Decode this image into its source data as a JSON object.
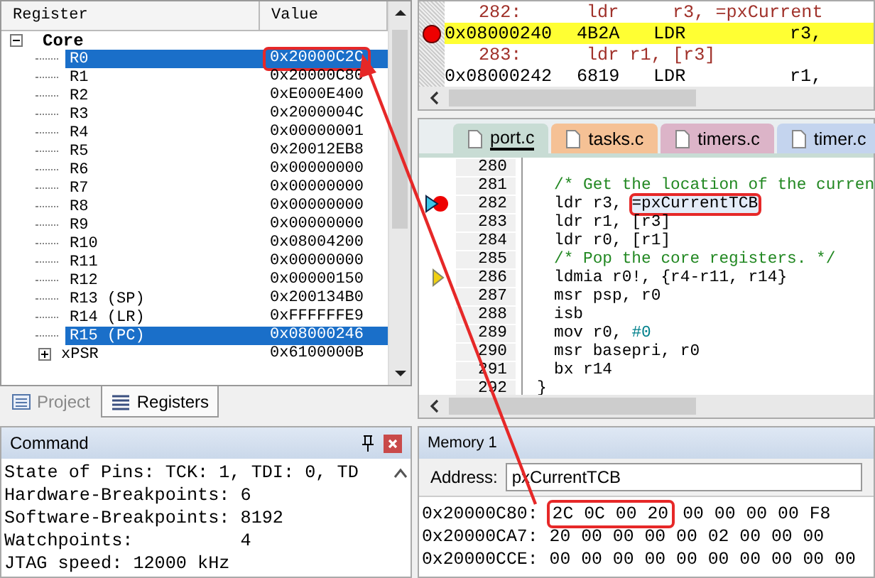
{
  "registers": {
    "columns": [
      "Register",
      "Value"
    ],
    "tree": [
      {
        "name": "Core",
        "expanded": true,
        "children": [
          {
            "name": "R0",
            "value": "0x20000C2C",
            "selected": true,
            "boxed": true
          },
          {
            "name": "R1",
            "value": "0x20000C80",
            "selected": false,
            "boxed": false
          },
          {
            "name": "R2",
            "value": "0xE000E400",
            "selected": false,
            "boxed": false
          },
          {
            "name": "R3",
            "value": "0x2000004C",
            "selected": false,
            "boxed": false
          },
          {
            "name": "R4",
            "value": "0x00000001",
            "selected": false,
            "boxed": false
          },
          {
            "name": "R5",
            "value": "0x20012EB8",
            "selected": false,
            "boxed": false
          },
          {
            "name": "R6",
            "value": "0x00000000",
            "selected": false,
            "boxed": false
          },
          {
            "name": "R7",
            "value": "0x00000000",
            "selected": false,
            "boxed": false
          },
          {
            "name": "R8",
            "value": "0x00000000",
            "selected": false,
            "boxed": false
          },
          {
            "name": "R9",
            "value": "0x00000000",
            "selected": false,
            "boxed": false
          },
          {
            "name": "R10",
            "value": "0x08004200",
            "selected": false,
            "boxed": false
          },
          {
            "name": "R11",
            "value": "0x00000000",
            "selected": false,
            "boxed": false
          },
          {
            "name": "R12",
            "value": "0x00000150",
            "selected": false,
            "boxed": false
          },
          {
            "name": "R13 (SP)",
            "value": "0x200134B0",
            "selected": false,
            "boxed": false
          },
          {
            "name": "R14 (LR)",
            "value": "0xFFFFFFE9",
            "selected": false,
            "boxed": false
          },
          {
            "name": "R15 (PC)",
            "value": "0x08000246",
            "selected": true,
            "boxed": false
          }
        ]
      },
      {
        "name": "xPSR",
        "value": "0x6100000B",
        "expanded": false
      }
    ]
  },
  "left_tabs": [
    {
      "label": "Project",
      "selected": false
    },
    {
      "label": "Registers",
      "selected": true
    }
  ],
  "command": {
    "title": "Command",
    "lines": [
      "State of Pins: TCK: 1, TDI: 0, TD",
      "Hardware-Breakpoints: 6",
      "Software-Breakpoints: 8192",
      "Watchpoints:          4",
      "JTAG speed: 12000 kHz"
    ]
  },
  "disassembly": {
    "lines": [
      {
        "kind": "source",
        "number": "282:",
        "code": "ldr     r3, =pxCurrent"
      },
      {
        "kind": "instruction",
        "address": "0x08000240",
        "opcode": "4B2A",
        "mnemonic": "LDR",
        "operands": "r3,",
        "current": true,
        "breakpoint": true
      },
      {
        "kind": "source",
        "number": "283:",
        "code": "ldr r1, [r3]"
      },
      {
        "kind": "instruction",
        "address": "0x08000242",
        "opcode": "6819",
        "mnemonic": "LDR",
        "operands": "r1,",
        "current": false,
        "breakpoint": false
      }
    ]
  },
  "editor": {
    "tabs": [
      {
        "label": "port.c",
        "selected": true,
        "color": "#c8dcd4"
      },
      {
        "label": "tasks.c",
        "selected": false,
        "color": "#f5c195"
      },
      {
        "label": "timers.c",
        "selected": false,
        "color": "#dcb4c8"
      },
      {
        "label": "timer.c",
        "selected": false,
        "color": "#c4d4ee"
      }
    ],
    "lines": [
      {
        "number": "280",
        "breakpoint": false,
        "current": false,
        "caller": false
      },
      {
        "number": "281",
        "breakpoint": false,
        "current": false,
        "caller": false,
        "parts": [
          {
            "kind": "comment",
            "text": "/* Get the location of the curren",
            "boxed": false
          }
        ]
      },
      {
        "number": "282",
        "breakpoint": true,
        "current": true,
        "caller": false,
        "parts": [
          {
            "kind": "code",
            "text": "ldr r3, ",
            "boxed": false
          },
          {
            "kind": "code",
            "text": "=pxCurrentTCB",
            "boxed": true
          }
        ]
      },
      {
        "number": "283",
        "breakpoint": false,
        "current": false,
        "caller": false,
        "parts": [
          {
            "kind": "code",
            "text": "ldr r1, [r3]",
            "boxed": false
          }
        ]
      },
      {
        "number": "284",
        "breakpoint": false,
        "current": false,
        "caller": false,
        "parts": [
          {
            "kind": "code",
            "text": "ldr r0, [r1]",
            "boxed": false
          }
        ]
      },
      {
        "number": "285",
        "breakpoint": false,
        "current": false,
        "caller": false,
        "parts": [
          {
            "kind": "comment",
            "text": "/* Pop the core registers. */",
            "boxed": false
          }
        ]
      },
      {
        "number": "286",
        "breakpoint": false,
        "current": false,
        "caller": true,
        "parts": [
          {
            "kind": "code",
            "text": "ldmia r0!, {r4-r11, r14}",
            "boxed": false
          }
        ]
      },
      {
        "number": "287",
        "breakpoint": false,
        "current": false,
        "caller": false,
        "parts": [
          {
            "kind": "code",
            "text": "msr psp, r0",
            "boxed": false
          }
        ]
      },
      {
        "number": "288",
        "breakpoint": false,
        "current": false,
        "caller": false,
        "parts": [
          {
            "kind": "code",
            "text": "isb",
            "boxed": false
          }
        ]
      },
      {
        "number": "289",
        "breakpoint": false,
        "current": false,
        "caller": false,
        "parts": [
          {
            "kind": "code",
            "text": "mov r0, ",
            "boxed": false
          },
          {
            "kind": "number",
            "text": "#0",
            "boxed": false
          }
        ]
      },
      {
        "number": "290",
        "breakpoint": false,
        "current": false,
        "caller": false,
        "parts": [
          {
            "kind": "code",
            "text": "msr basepri, r0",
            "boxed": false
          }
        ]
      },
      {
        "number": "291",
        "breakpoint": false,
        "current": false,
        "caller": false,
        "parts": [
          {
            "kind": "code",
            "text": "bx r14",
            "boxed": false
          }
        ]
      },
      {
        "number": "292",
        "breakpoint": false,
        "current": false,
        "caller": false,
        "parts": [
          {
            "kind": "brace",
            "text": "}",
            "boxed": false
          }
        ]
      }
    ]
  },
  "memory": {
    "title": "Memory 1",
    "address_label": "Address:",
    "address": "pxCurrentTCB",
    "rows": [
      {
        "address": "0x20000C80:",
        "groups": [
          {
            "text": "2C 0C 00 20",
            "boxed": true
          },
          {
            "text": "00 00 00 00 F8",
            "boxed": false
          }
        ]
      },
      {
        "address": "0x20000CA7:",
        "groups": [
          {
            "text": "20 00 00 00 00 02 00 00 00",
            "boxed": false
          }
        ]
      },
      {
        "address": "0x20000CCE:",
        "groups": [
          {
            "text": "00 00 00 00 00 00 00 00 00 00",
            "boxed": false
          }
        ]
      }
    ]
  }
}
